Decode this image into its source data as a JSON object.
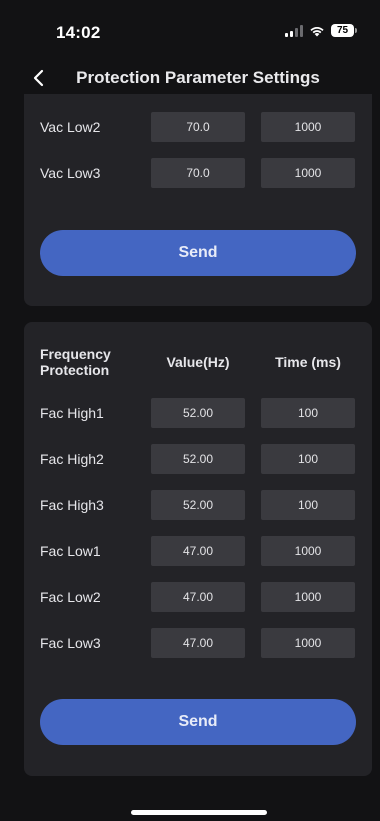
{
  "status_bar": {
    "time": "14:02",
    "battery": "75",
    "icons": [
      "cellular-signal-icon",
      "wifi-icon",
      "battery-icon"
    ]
  },
  "nav": {
    "back_icon": "chevron-left-icon",
    "title": "Protection Parameter Settings"
  },
  "voltage_section": {
    "rows": [
      {
        "label": "Vac Low2",
        "value": "70.0",
        "time": "1000"
      },
      {
        "label": "Vac Low3",
        "value": "70.0",
        "time": "1000"
      }
    ],
    "send_label": "Send"
  },
  "frequency_section": {
    "header": {
      "label": "Frequency Protection",
      "value": "Value(Hz)",
      "time": "Time (ms)"
    },
    "rows": [
      {
        "label": "Fac High1",
        "value": "52.00",
        "time": "100"
      },
      {
        "label": "Fac High2",
        "value": "52.00",
        "time": "100"
      },
      {
        "label": "Fac High3",
        "value": "52.00",
        "time": "100"
      },
      {
        "label": "Fac Low1",
        "value": "47.00",
        "time": "1000"
      },
      {
        "label": "Fac Low2",
        "value": "47.00",
        "time": "1000"
      },
      {
        "label": "Fac Low3",
        "value": "47.00",
        "time": "1000"
      }
    ],
    "send_label": "Send"
  },
  "colors": {
    "background": "#121214",
    "card": "#232327",
    "input": "#3a3a3f",
    "accent": "#4466c2"
  }
}
